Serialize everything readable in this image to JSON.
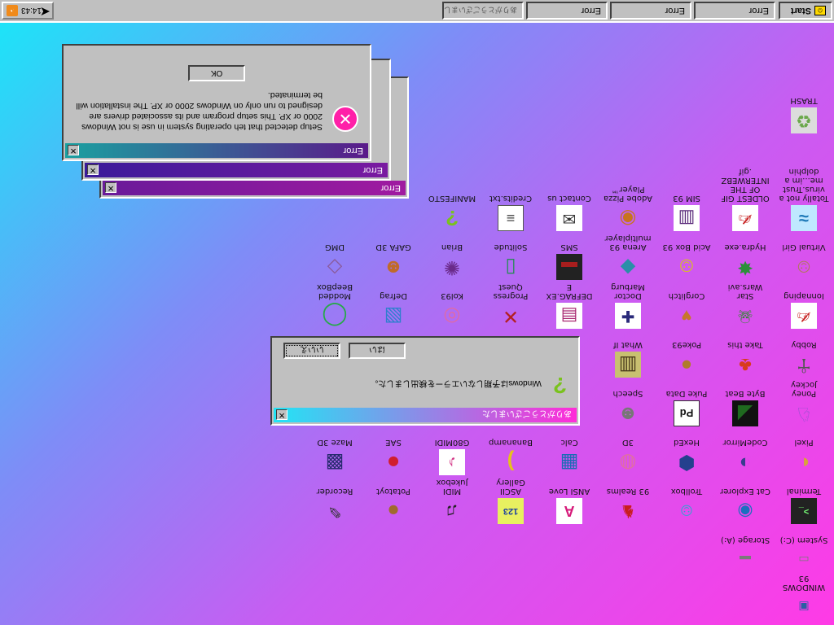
{
  "taskbar": {
    "start_label": "Start",
    "tasks": [
      "Error",
      "Error",
      "Error",
      "ありがとうございました"
    ],
    "clock": "14:43"
  },
  "desktop": {
    "icons": [
      {
        "label": "WINDOWS 93",
        "icon": "computer-icon",
        "symbol": "▣",
        "color": "#2b5fa3"
      },
      {
        "label": "System (C:)",
        "icon": "drive-icon",
        "symbol": "▭",
        "color": "#7a7a7a"
      },
      {
        "label": "Storage (A:)",
        "icon": "floppy-drive-icon",
        "symbol": "▬",
        "color": "#7a7a7a"
      },
      {
        "label": "Terminal",
        "icon": "terminal-icon",
        "symbol": ">_",
        "color": "#111111"
      },
      {
        "label": "Cat Explorer",
        "icon": "globe-cat-icon",
        "symbol": "◉",
        "color": "#1c6fbf"
      },
      {
        "label": "Trollbox",
        "icon": "trollbox-icon",
        "symbol": "☺",
        "color": "#2aa7d0"
      },
      {
        "label": "93 Realms",
        "icon": "realms-icon",
        "symbol": "♞",
        "color": "#c81e1e"
      },
      {
        "label": "ANSI Love",
        "icon": "ansi-icon",
        "symbol": "A",
        "color": "#d61a7a"
      },
      {
        "label": "ASCII Gallery",
        "icon": "ascii-icon",
        "symbol": "123",
        "color": "#1a3fa0"
      },
      {
        "label": "MIDI Jukebox",
        "icon": "jukebox-icon",
        "symbol": "♫",
        "color": "#222222"
      },
      {
        "label": "Potatoyt",
        "icon": "potato-icon",
        "symbol": "●",
        "color": "#a06a2c"
      },
      {
        "label": "Recorder",
        "icon": "microphone-icon",
        "symbol": "✎",
        "color": "#333333"
      },
      {
        "label": "Pixel",
        "icon": "palette-icon",
        "symbol": "◐",
        "color": "#d9a33c"
      },
      {
        "label": "CodeMirror",
        "icon": "codemirror-icon",
        "symbol": "◑",
        "color": "#3b3b8f"
      },
      {
        "label": "HexEd",
        "icon": "hex-icon",
        "symbol": "⬢",
        "color": "#24408e"
      },
      {
        "label": "3D",
        "icon": "3d-brain-icon",
        "symbol": "◍",
        "color": "#e06fa0"
      },
      {
        "label": "Calc",
        "icon": "calculator-icon",
        "symbol": "▦",
        "color": "#1a6bb5"
      },
      {
        "label": "Bananamp",
        "icon": "banana-icon",
        "symbol": ")",
        "color": "#e5c21c"
      },
      {
        "label": "G80MIDI",
        "icon": "g80midi-icon",
        "symbol": "♪",
        "color": "#d43b8a"
      },
      {
        "label": "SAE",
        "icon": "ball-icon",
        "symbol": "●",
        "color": "#d01e2e"
      },
      {
        "label": "Maze 3D",
        "icon": "maze-icon",
        "symbol": "▩",
        "color": "#262a6e"
      },
      {
        "label": "Poney Jockey",
        "icon": "pony-icon",
        "symbol": "♘",
        "color": "#9c4fd1"
      },
      {
        "label": "Byte Beat",
        "icon": "bytebeat-icon",
        "symbol": "◢",
        "color": "#1f6a1f"
      },
      {
        "label": "Puke Data",
        "icon": "pd-icon",
        "symbol": "Pd",
        "color": "#111111"
      },
      {
        "label": "Speech",
        "icon": "face-icon",
        "symbol": "☻",
        "color": "#777777"
      },
      {
        "label": "Robby",
        "icon": "robby-icon",
        "symbol": "☥",
        "color": "#555555"
      },
      {
        "label": "Take this",
        "icon": "mushroom-icon",
        "symbol": "♣",
        "color": "#d83b1f"
      },
      {
        "label": "Poke93",
        "icon": "poke-icon",
        "symbol": "●",
        "color": "#b07b2a"
      },
      {
        "label": "What If",
        "icon": "whatif-icon",
        "symbol": "▥",
        "color": "#4a3c1c"
      },
      {
        "label": "Ionnaping",
        "icon": "pen-paper-icon",
        "symbol": "✍",
        "color": "#c62020"
      },
      {
        "label": "Star Wars.avi",
        "icon": "yoda-icon",
        "symbol": "☠",
        "color": "#2e8a2e"
      },
      {
        "label": "Corglitch",
        "icon": "dog-icon",
        "symbol": "♥",
        "color": "#c7762b"
      },
      {
        "label": "Doctor Marburg",
        "icon": "doctor-icon",
        "symbol": "✚",
        "color": "#2a2a7a"
      },
      {
        "label": "DEFRAG.EXE",
        "icon": "defrag-icon",
        "symbol": "▤",
        "color": "#a82a72"
      },
      {
        "label": "Progress Quest",
        "icon": "swords-icon",
        "symbol": "✕",
        "color": "#b31f1f"
      },
      {
        "label": "Kol93",
        "icon": "pig-icon",
        "symbol": "◎",
        "color": "#e06aa4"
      },
      {
        "label": "Defrag",
        "icon": "cube-icon",
        "symbol": "▧",
        "color": "#2e7fce"
      },
      {
        "label": "Modded BeepBox",
        "icon": "beepbox-icon",
        "symbol": "◯",
        "color": "#28a84a"
      },
      {
        "label": "Virtual Girl",
        "icon": "virtualgirl-icon",
        "symbol": "☺",
        "color": "#b0785a"
      },
      {
        "label": "Hydra.exe",
        "icon": "hydra-icon",
        "symbol": "✸",
        "color": "#2c8f3a"
      },
      {
        "label": "Acid Box 93",
        "icon": "acid-icon",
        "symbol": "☺",
        "color": "#d8c020"
      },
      {
        "label": "Arena 93 multiplayer",
        "icon": "arena-icon",
        "symbol": "◆",
        "color": "#2a8fa8"
      },
      {
        "label": "SMS",
        "icon": "sms-icon",
        "symbol": "▬",
        "color": "#a81e1e"
      },
      {
        "label": "Solitude",
        "icon": "solitude-icon",
        "symbol": "▯",
        "color": "#2a8a5a"
      },
      {
        "label": "Brian",
        "icon": "brian-icon",
        "symbol": "✺",
        "color": "#6a2a8a"
      },
      {
        "label": "GAFA 3D",
        "icon": "gafa-icon",
        "symbol": "☻",
        "color": "#c06a2a"
      },
      {
        "label": "DMG",
        "icon": "dmg-icon",
        "symbol": "◇",
        "color": "#8a5a9a"
      },
      {
        "label": "Totally not a virus.Trust me...im a dolphin",
        "icon": "dolphin-icon",
        "symbol": "≈",
        "color": "#1f7ab8"
      },
      {
        "label": "OLDEST GIF OF THE INTERWEBZ.gif",
        "icon": "gif-icon",
        "symbol": "✍",
        "color": "#c62020"
      },
      {
        "label": "SIM 93",
        "icon": "sim-icon",
        "symbol": "▥",
        "color": "#5a2a7a"
      },
      {
        "label": "Adobe Pizza Player™",
        "icon": "pizza-icon",
        "symbol": "◉",
        "color": "#c8741e"
      },
      {
        "label": "Contact us",
        "icon": "contact-icon",
        "symbol": "✉",
        "color": "#333333"
      },
      {
        "label": "Credits.txt",
        "icon": "text-file-icon",
        "symbol": "≡",
        "color": "#444444"
      },
      {
        "label": "MANIFESTO",
        "icon": "manifesto-icon",
        "symbol": "?",
        "color": "#7ac21e"
      },
      {
        "label": "TRASH",
        "icon": "trash-icon",
        "symbol": "♻",
        "color": "#6aa84a"
      }
    ]
  },
  "error_dialog": {
    "title": "Error",
    "message": "Setup detected that teh operating system in use is not Windows 2000 or XP. This setup program and its associated drivers are designed to run only on Windows 2000 or XP. The installation will be terminated.",
    "ok_label": "OK",
    "stack_titles": [
      "Error",
      "Error"
    ]
  },
  "jp_dialog": {
    "title": "ありがとうございました",
    "message": "Windowsは予期しないエラーを検出しました。",
    "yes_label": "はい",
    "no_label": "いいえ"
  }
}
